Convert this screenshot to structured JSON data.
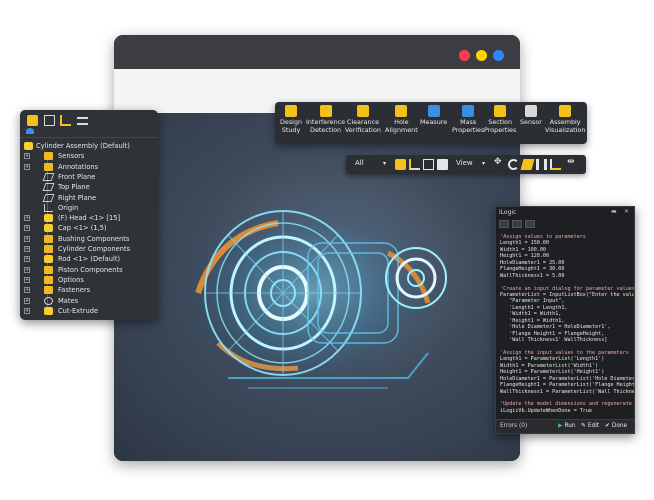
{
  "window": {
    "colors": {
      "close": "#ff3b4e",
      "minimize": "#ffd400",
      "maximize": "#2a86ff"
    }
  },
  "tree": {
    "toolbar_icons": [
      "part-icon",
      "document-icon",
      "assembly-structure-icon",
      "menu-icon",
      "filter-icon"
    ],
    "items": [
      {
        "label": "Cylinder Assembly (Default)",
        "icon": "assembly-icon",
        "level": 0
      },
      {
        "label": "Sensors",
        "icon": "folder-icon",
        "level": 1
      },
      {
        "label": "Annotations",
        "icon": "folder-icon",
        "level": 1
      },
      {
        "label": "Front Plane",
        "icon": "plane-icon",
        "level": 1
      },
      {
        "label": "Top Plane",
        "icon": "plane-icon",
        "level": 1
      },
      {
        "label": "Right Plane",
        "icon": "plane-icon",
        "level": 1
      },
      {
        "label": "Origin",
        "icon": "origin-icon",
        "level": 1
      },
      {
        "label": "(F) Head <1> [15]",
        "icon": "part-icon",
        "level": 1
      },
      {
        "label": "Cap <1> (1,5)",
        "icon": "part-icon",
        "level": 1
      },
      {
        "label": "Bushing Components",
        "icon": "folder-icon",
        "level": 1
      },
      {
        "label": "Cylinder Components",
        "icon": "folder-icon",
        "level": 1
      },
      {
        "label": "Rod <1> (Default)",
        "icon": "part-icon",
        "level": 1
      },
      {
        "label": "Piston Components",
        "icon": "folder-icon",
        "level": 1
      },
      {
        "label": "Options",
        "icon": "folder-icon",
        "level": 1
      },
      {
        "label": "Fasteners",
        "icon": "folder-icon",
        "level": 1
      },
      {
        "label": "Mates",
        "icon": "mates-icon",
        "level": 1
      },
      {
        "label": "Cut-Extrude",
        "icon": "cut-extrude-icon",
        "level": 1
      }
    ]
  },
  "ribbon": {
    "buttons": [
      {
        "label": "Design\nStudy",
        "icon": "design-study-icon",
        "color": "#f2c21b"
      },
      {
        "label": "Interference\nDetection",
        "icon": "interference-icon",
        "color": "#f2c21b"
      },
      {
        "label": "Clearance\nVerification",
        "icon": "clearance-icon",
        "color": "#f2c21b"
      },
      {
        "label": "Hole\nAlignment",
        "icon": "hole-alignment-icon",
        "color": "#f2c21b"
      },
      {
        "label": "Measure",
        "icon": "measure-icon",
        "color": "#3a8ee6"
      },
      {
        "label": "Mass\nProperties",
        "icon": "mass-properties-icon",
        "color": "#3a8ee6"
      },
      {
        "label": "Section\nProperties",
        "icon": "section-properties-icon",
        "color": "#f2c21b"
      },
      {
        "label": "Sensor",
        "icon": "sensor-icon",
        "color": "#d9d9d9"
      },
      {
        "label": "Assembly\nVisualization",
        "icon": "assembly-visualization-icon",
        "color": "#f2c21b"
      }
    ]
  },
  "viewbar": {
    "filter_value": "All",
    "view_label": "View"
  },
  "ilogic": {
    "title": "iLogic",
    "code_lines": [
      {
        "text": "'Assign values to parameters",
        "type": "comment"
      },
      {
        "text": "Length1 = 150.00",
        "type": "code"
      },
      {
        "text": "Width1 = 100.00",
        "type": "code"
      },
      {
        "text": "Height1 = 120.00",
        "type": "code"
      },
      {
        "text": "HoleDiameter1 = 25.00",
        "type": "code"
      },
      {
        "text": "FlangeHeight1 = 30.00",
        "type": "code"
      },
      {
        "text": "WallThickness1 = 5.00",
        "type": "code"
      },
      {
        "text": "",
        "type": "code"
      },
      {
        "text": "'Create an input dialog for parameter values",
        "type": "comment"
      },
      {
        "text": "ParameterList = InputListBox(\"Enter the values:\",",
        "type": "code"
      },
      {
        "text": "   \"Parameter Input\",",
        "type": "code"
      },
      {
        "text": "   'Length1 = Length1,",
        "type": "code"
      },
      {
        "text": "   'Width1 = Width1,",
        "type": "code"
      },
      {
        "text": "   'Height1 = Width1,",
        "type": "code"
      },
      {
        "text": "   'Hole Diameter1 = HoleDiameter1',",
        "type": "code"
      },
      {
        "text": "   'Flange Height1 = FlangeHeight,",
        "type": "code"
      },
      {
        "text": "   'Wall Thickness1' WallThickness]",
        "type": "code"
      },
      {
        "text": "",
        "type": "code"
      },
      {
        "text": "'Assign the input values to the parameters",
        "type": "comment"
      },
      {
        "text": "Length1 = ParameterList('Length1')",
        "type": "code"
      },
      {
        "text": "Width1 = ParameterList('Width1')",
        "type": "code"
      },
      {
        "text": "Height1 = ParameterList('Height1')",
        "type": "code"
      },
      {
        "text": "HoleDiameter1 = ParameterList('Hole Diameter')",
        "type": "code"
      },
      {
        "text": "FlangeHeight1 = ParameterList('Flange Height')",
        "type": "code"
      },
      {
        "text": "WallThickness1 = ParameterList('Wall Thickness')",
        "type": "code"
      },
      {
        "text": "",
        "type": "code"
      },
      {
        "text": "'Update the model dimensions and regenerate the m",
        "type": "comment"
      },
      {
        "text": "iLogicVb.UpdateWhenDone = True",
        "type": "code"
      }
    ],
    "footer": {
      "errors_label": "Errors (0)",
      "run_label": "Run",
      "edit_label": "Edit",
      "done_label": "Done"
    }
  }
}
